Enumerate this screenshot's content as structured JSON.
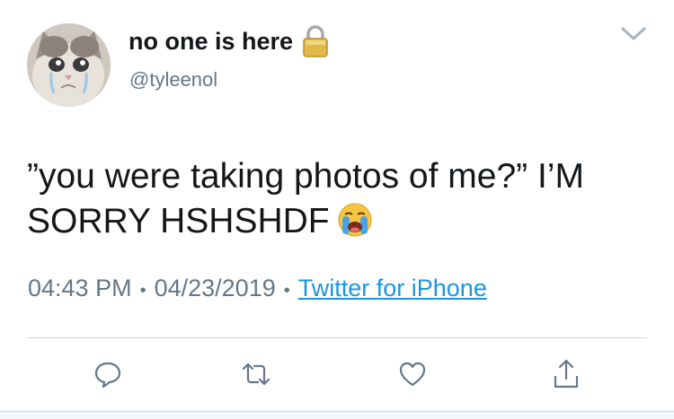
{
  "user": {
    "display_name": "no one is here",
    "handle": "@tyleenol",
    "avatar_icon": "crying-cat-avatar",
    "protected_icon": "lock-icon"
  },
  "tweet": {
    "text": "”you were taking photos of me?” I’M SORRY HSHSHDF",
    "emoji": "loudly-crying-face-emoji"
  },
  "meta": {
    "time": "04:43 PM",
    "separator": "•",
    "date": "04/23/2019",
    "source": "Twitter for iPhone"
  },
  "actions": [
    "reply-icon",
    "retweet-icon",
    "like-icon",
    "share-icon"
  ],
  "colors": {
    "text": "#14171a",
    "secondary": "#657786",
    "link": "#1b95e0",
    "divider": "#ccd6dd",
    "icon": "#657786"
  }
}
